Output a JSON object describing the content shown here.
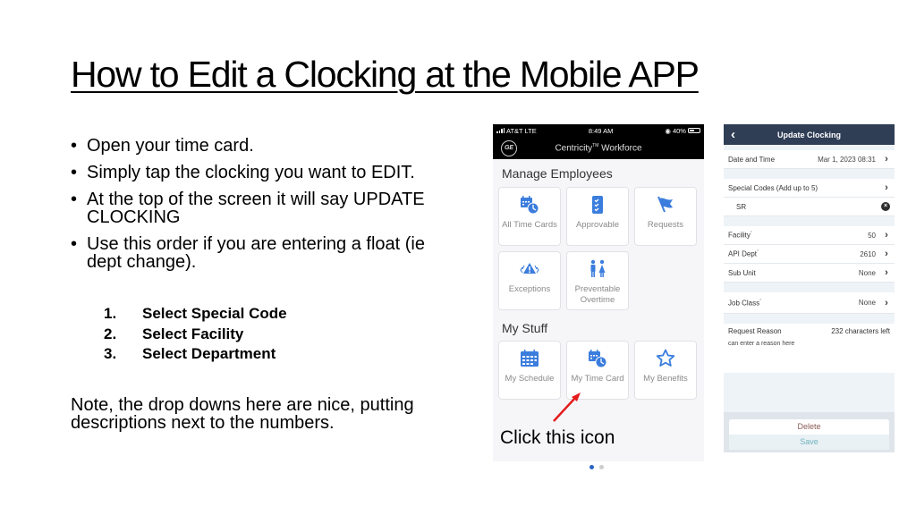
{
  "slide": {
    "title": "How to Edit a Clocking at the Mobile APP",
    "bullets": [
      "Open your time card.",
      "Simply tap the clocking you want to EDIT.",
      "At the top of the screen it will say UPDATE CLOCKING",
      "Use this order if you are entering a float (ie dept change)."
    ],
    "steps": [
      {
        "num": "1.",
        "label": "Select Special Code"
      },
      {
        "num": "2.",
        "label": "Select Facility"
      },
      {
        "num": "3.",
        "label": "Select Department"
      }
    ],
    "note": "Note, the drop downs here are nice, putting descriptions next to the numbers.",
    "callout": "Click this icon",
    "callout_color": "#e31b1b"
  },
  "phone_home": {
    "status": {
      "carrier": "AT&T LTE",
      "time": "8:49 AM",
      "battery": "40%"
    },
    "app_title": "Centricity",
    "app_title_tm": "TM",
    "app_title_suffix": " Workforce",
    "logo": "GE",
    "accent_color": "#3b7ddd",
    "sections": [
      {
        "title": "Manage Employees",
        "tiles": [
          {
            "label": "All Time Cards",
            "icon": "calendar-clock-icon"
          },
          {
            "label": "Approvable",
            "icon": "checklist-icon"
          },
          {
            "label": "Requests",
            "icon": "flag-icon"
          },
          {
            "label": "Exceptions",
            "icon": "alert-icon"
          },
          {
            "label": "Preventable Overtime",
            "icon": "people-icon"
          }
        ]
      },
      {
        "title": "My Stuff",
        "tiles": [
          {
            "label": "My Schedule",
            "icon": "calendar-icon"
          },
          {
            "label": "My Time Card",
            "icon": "calendar-clock-icon"
          },
          {
            "label": "My Benefits",
            "icon": "star-icon"
          }
        ]
      }
    ],
    "page_dots": {
      "count": 2,
      "active": 0,
      "active_color": "#2a63c4",
      "inactive_color": "#cccccc"
    }
  },
  "phone_update": {
    "title": "Update Clocking",
    "header_color": "#2f3e55",
    "date_time": {
      "label": "Date and Time",
      "value": "Mar 1, 2023 08:31"
    },
    "special_codes": {
      "label": "Special Codes (Add up to 5)",
      "selected": "SR"
    },
    "fields": [
      {
        "label": "Facility",
        "required": "*",
        "value": "50"
      },
      {
        "label": "API Dept",
        "required": "*",
        "value": "2610"
      },
      {
        "label": "Sub Unit",
        "required": "",
        "value": "None"
      }
    ],
    "job_class": {
      "label": "Job Class",
      "required": "*",
      "value": "None"
    },
    "request_reason": {
      "label": "Request Reason",
      "counter": "232 characters left",
      "placeholder": "can enter a reason here"
    },
    "delete_label": "Delete",
    "save_label": "Save"
  }
}
